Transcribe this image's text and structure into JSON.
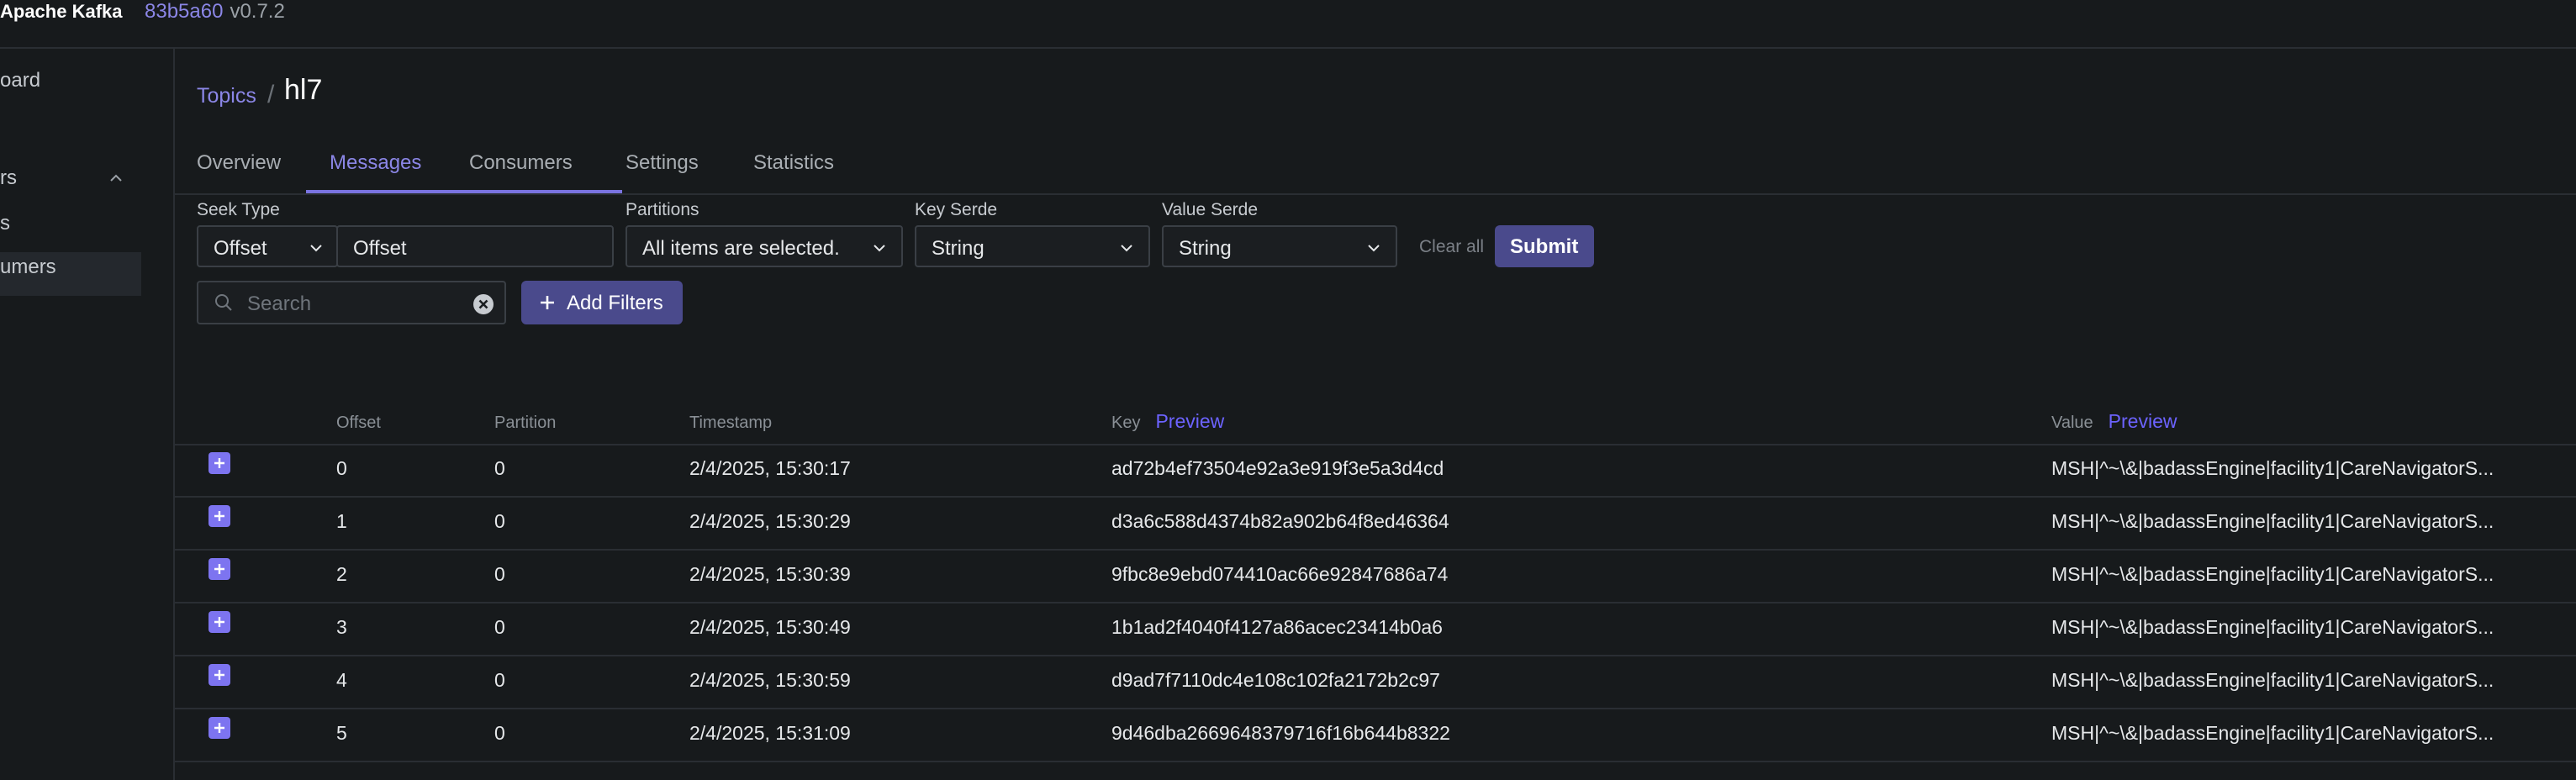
{
  "topnav": {
    "brand": "Apache Kafka",
    "commit_hash": "83b5a60",
    "version": "v0.7.2"
  },
  "sidebar": {
    "items": [
      {
        "label": "oard"
      },
      {
        "label": "rs"
      },
      {
        "label": "s"
      },
      {
        "label": "umers"
      }
    ]
  },
  "breadcrumb": {
    "link": "Topics",
    "separator": "/",
    "current": "hl7"
  },
  "tabs": [
    {
      "label": "Overview"
    },
    {
      "label": "Messages"
    },
    {
      "label": "Consumers"
    },
    {
      "label": "Settings"
    },
    {
      "label": "Statistics"
    }
  ],
  "filters": {
    "seek_type_label": "Seek Type",
    "seek_type_value": "Offset",
    "offset_value": "Offset",
    "partitions_label": "Partitions",
    "partitions_value": "All items are selected.",
    "key_serde_label": "Key Serde",
    "key_serde_value": "String",
    "value_serde_label": "Value Serde",
    "value_serde_value": "String",
    "clear_all": "Clear all",
    "submit": "Submit",
    "search_placeholder": "Search",
    "add_filters": "Add Filters"
  },
  "table": {
    "headers": {
      "offset": "Offset",
      "partition": "Partition",
      "timestamp": "Timestamp",
      "key": "Key",
      "key_preview": "Preview",
      "value": "Value",
      "value_preview": "Preview"
    },
    "rows": [
      {
        "offset": "0",
        "partition": "0",
        "timestamp": "2/4/2025, 15:30:17",
        "key": "ad72b4ef73504e92a3e919f3e5a3d4cd",
        "value": "MSH|^~\\&|badassEngine|facility1|CareNavigatorS..."
      },
      {
        "offset": "1",
        "partition": "0",
        "timestamp": "2/4/2025, 15:30:29",
        "key": "d3a6c588d4374b82a902b64f8ed46364",
        "value": "MSH|^~\\&|badassEngine|facility1|CareNavigatorS..."
      },
      {
        "offset": "2",
        "partition": "0",
        "timestamp": "2/4/2025, 15:30:39",
        "key": "9fbc8e9ebd074410ac66e92847686a74",
        "value": "MSH|^~\\&|badassEngine|facility1|CareNavigatorS..."
      },
      {
        "offset": "3",
        "partition": "0",
        "timestamp": "2/4/2025, 15:30:49",
        "key": "1b1ad2f4040f4127a86acec23414b0a6",
        "value": "MSH|^~\\&|badassEngine|facility1|CareNavigatorS..."
      },
      {
        "offset": "4",
        "partition": "0",
        "timestamp": "2/4/2025, 15:30:59",
        "key": "d9ad7f7110dc4e108c102fa2172b2c97",
        "value": "MSH|^~\\&|badassEngine|facility1|CareNavigatorS..."
      },
      {
        "offset": "5",
        "partition": "0",
        "timestamp": "2/4/2025, 15:31:09",
        "key": "9d46dba2669648379716f16b644b8322",
        "value": "MSH|^~\\&|badassEngine|facility1|CareNavigatorS..."
      }
    ]
  },
  "colors": {
    "background": "#171a1c",
    "accent": "#8b86e6",
    "button": "#4a4a8c",
    "expand_icon": "#7d74f0"
  }
}
